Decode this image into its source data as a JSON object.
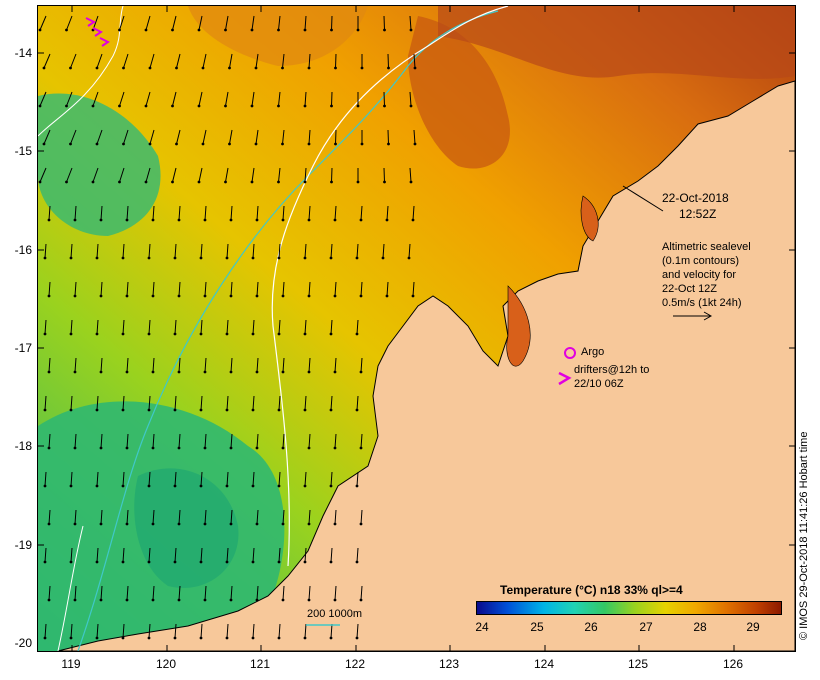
{
  "axes": {
    "y_ticks": [
      "-14",
      "-15",
      "-16",
      "-17",
      "-18",
      "-19",
      "-20"
    ],
    "x_ticks": [
      "119",
      "120",
      "121",
      "122",
      "123",
      "124",
      "125",
      "126"
    ]
  },
  "annotations": {
    "date_line1": "22-Oct-2018",
    "date_line2": "12:52Z",
    "altimetric": [
      "Altimetric sealevel",
      "(0.1m contours)",
      "and velocity for",
      "22-Oct 12Z",
      "0.5m/s (1kt 24h)"
    ],
    "argo_label": "Argo",
    "drifters_line1": "drifters@12h to",
    "drifters_line2": "22/10 06Z",
    "scale_label": "200  1000m"
  },
  "legend": {
    "title": "Temperature (°C) n18 33% ql>=4",
    "ticks": [
      "24",
      "25",
      "26",
      "27",
      "28",
      "29"
    ]
  },
  "credit": "© IMOS 29-Oct-2018 11:41:26 Hobart time",
  "colors": {
    "land": "#f7c89a",
    "isobath_200": "#ffffff",
    "isobath_1000": "#40c8c8",
    "argo": "#e000e0",
    "drifter": "#e000e0"
  }
}
